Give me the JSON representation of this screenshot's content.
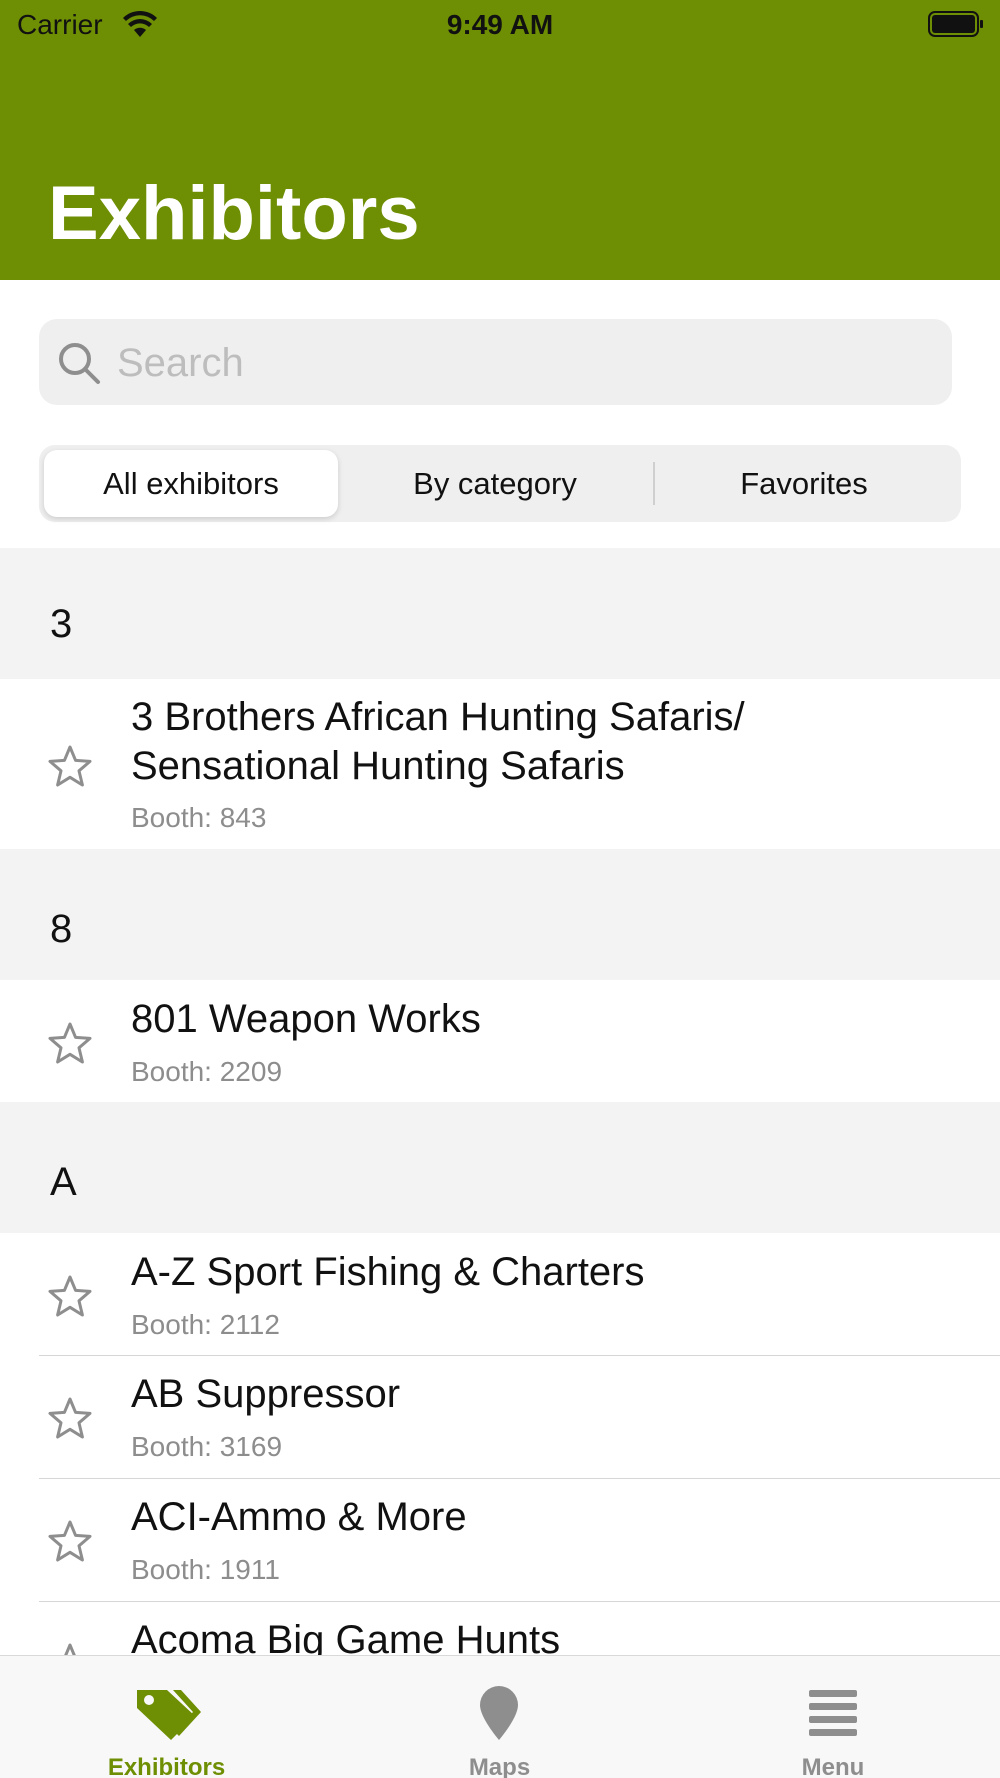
{
  "status_bar": {
    "carrier": "Carrier",
    "time": "9:49 AM"
  },
  "header": {
    "title": "Exhibitors",
    "background": "#6e8e04"
  },
  "search": {
    "placeholder": "Search"
  },
  "segments": [
    {
      "label": "All exhibitors",
      "selected": true
    },
    {
      "label": "By category",
      "selected": false
    },
    {
      "label": "Favorites",
      "selected": false
    }
  ],
  "sections": [
    {
      "letter": "3",
      "items": [
        {
          "name_line1": "3 Brothers African Hunting Safaris/",
          "name_line2": "Sensational Hunting Safaris",
          "booth": "Booth: 843"
        }
      ]
    },
    {
      "letter": "8",
      "items": [
        {
          "name": "801 Weapon Works",
          "booth": "Booth: 2209"
        }
      ]
    },
    {
      "letter": "A",
      "items": [
        {
          "name": "A-Z Sport Fishing & Charters",
          "booth": "Booth: 2112"
        },
        {
          "name": "AB Suppressor",
          "booth": "Booth: 3169"
        },
        {
          "name": "ACI-Ammo & More",
          "booth": "Booth: 1911"
        },
        {
          "name": "Acoma Big Game Hunts"
        }
      ]
    }
  ],
  "tabbar": {
    "tabs": [
      {
        "label": "Exhibitors",
        "icon": "tag-icon",
        "active": true
      },
      {
        "label": "Maps",
        "icon": "map-pin-icon",
        "active": false
      },
      {
        "label": "Menu",
        "icon": "hamburger-menu-icon",
        "active": false
      }
    ],
    "active_color": "#6e8e04",
    "inactive_color": "#8e8e8e"
  }
}
